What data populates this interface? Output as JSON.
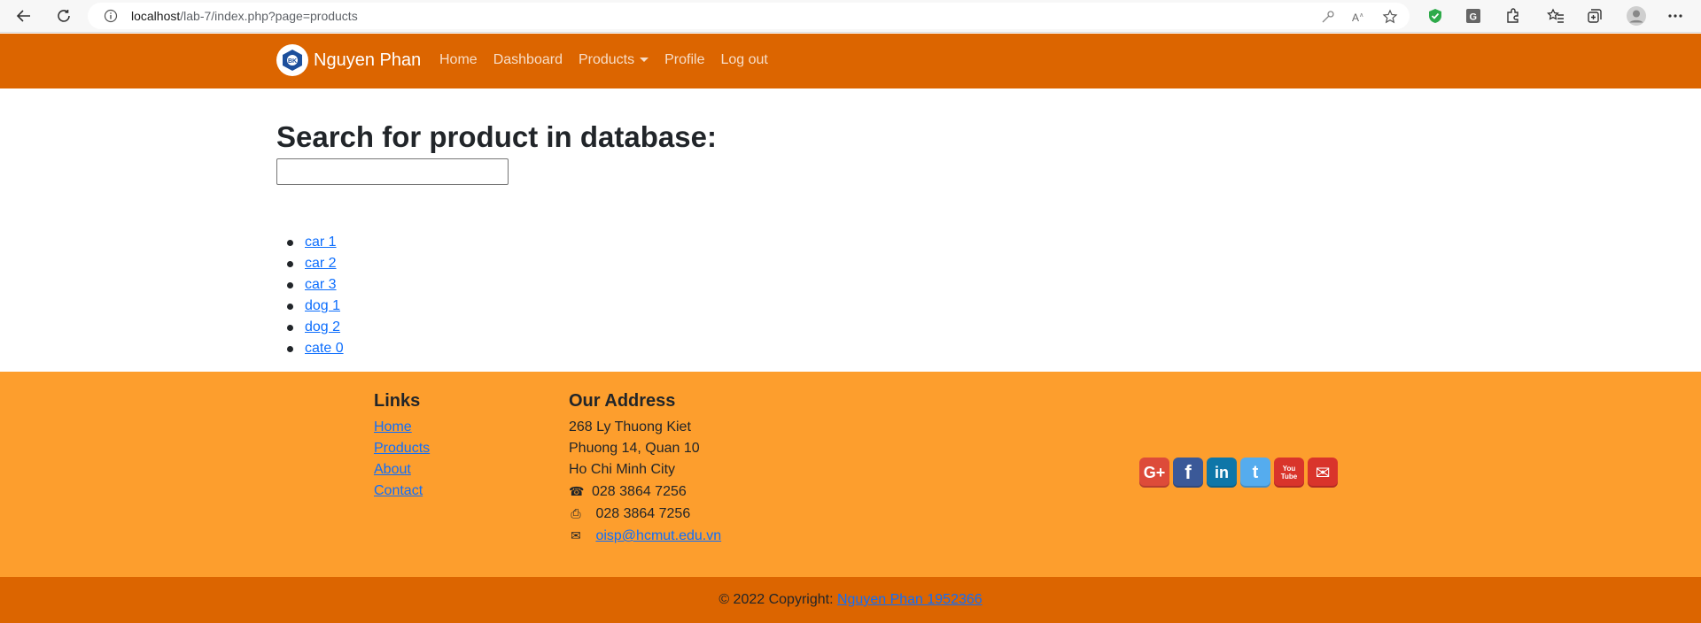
{
  "browser": {
    "url_host": "localhost",
    "url_path": "/lab-7/index.php?page=products"
  },
  "navbar": {
    "brand": "Nguyen Phan",
    "links": [
      {
        "label": "Home"
      },
      {
        "label": "Dashboard"
      },
      {
        "label": "Products"
      },
      {
        "label": "Profile"
      },
      {
        "label": "Log out"
      }
    ]
  },
  "main": {
    "title": "Search for product in database:",
    "search_value": "",
    "results": [
      "car 1",
      "car 2",
      "car 3",
      "dog 1",
      "dog 2",
      "cate 0"
    ]
  },
  "footer": {
    "links_heading": "Links",
    "links": [
      "Home",
      "Products",
      "About",
      "Contact"
    ],
    "address_heading": "Our Address",
    "address_lines": [
      "268 Ly Thuong Kiet",
      "Phuong 14, Quan 10",
      "Ho Chi Minh City"
    ],
    "phone": "028 3864 7256",
    "fax": "028 3864 7256",
    "email": "oisp@hcmut.edu.vn",
    "social": [
      {
        "icon": "google-plus-icon",
        "glyph": "G+",
        "color": "#dd4b39"
      },
      {
        "icon": "facebook-icon",
        "glyph": "f",
        "color": "#3b5998"
      },
      {
        "icon": "linkedin-icon",
        "glyph": "in",
        "color": "#0e76a8"
      },
      {
        "icon": "twitter-icon",
        "glyph": "t",
        "color": "#55acee"
      },
      {
        "icon": "youtube-icon",
        "glyph": "You Tube",
        "color": "#d9342b"
      },
      {
        "icon": "mail-icon",
        "glyph": "✉",
        "color": "#d9342b"
      }
    ],
    "copyright_prefix": "© 2022 Copyright: ",
    "copyright_link": "Nguyen Phan 1952366"
  },
  "colors": {
    "navbar": "#dc6500",
    "footer": "#fd9e2d",
    "link": "#0d6efd"
  }
}
